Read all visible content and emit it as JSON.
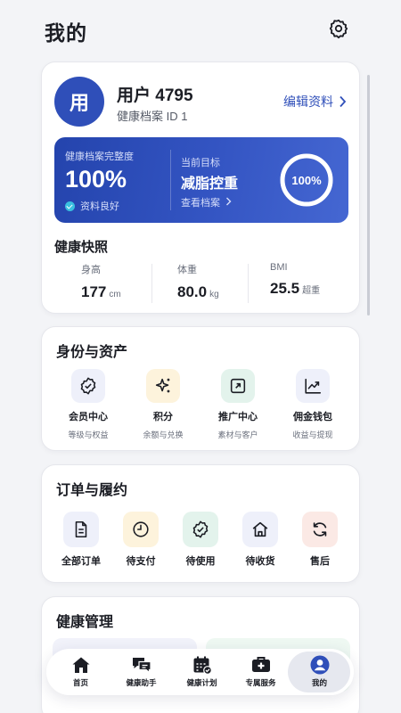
{
  "page": {
    "title": "我的"
  },
  "profile": {
    "avatar_text": "用",
    "name": "用户 4795",
    "subtitle": "健康档案 ID 1",
    "edit_label": "编辑资料",
    "banner": {
      "completeness_label": "健康档案完整度",
      "completeness_value": "100%",
      "status_text": "资料良好",
      "goal_label": "当前目标",
      "goal_value": "减脂控重",
      "view_label": "查看档案",
      "ring_text": "100%",
      "ring_progress": 1.0
    },
    "snapshot_title": "健康快照",
    "metrics": [
      {
        "label": "身高",
        "value": "177",
        "unit": "cm"
      },
      {
        "label": "体重",
        "value": "80.0",
        "unit": "kg"
      },
      {
        "label": "BMI",
        "value": "25.5",
        "unit": "超重"
      }
    ]
  },
  "identity": {
    "title": "身份与资产",
    "items": [
      {
        "label": "会员中心",
        "sub": "等级与权益",
        "icon": "badge-check-icon",
        "bg": "#eef0fa",
        "color": "#2f4fb9"
      },
      {
        "label": "积分",
        "sub": "余额与兑换",
        "icon": "sparkles-icon",
        "bg": "#fdf3dc",
        "color": "#1b1d24"
      },
      {
        "label": "推广中心",
        "sub": "素材与客户",
        "icon": "share-out-icon",
        "bg": "#e3f3ec",
        "color": "#1b1d24"
      },
      {
        "label": "佣金钱包",
        "sub": "收益与提现",
        "icon": "trend-chart-icon",
        "bg": "#eef0fa",
        "color": "#1b1d24"
      }
    ]
  },
  "orders": {
    "title": "订单与履约",
    "items": [
      {
        "label": "全部订单",
        "icon": "document-icon",
        "bg": "#eef0fa"
      },
      {
        "label": "待支付",
        "icon": "clock-icon",
        "bg": "#fdf3dc"
      },
      {
        "label": "待使用",
        "icon": "badge-check-icon",
        "bg": "#e3f3ec"
      },
      {
        "label": "待收货",
        "icon": "home-icon",
        "bg": "#eef0fa"
      },
      {
        "label": "售后",
        "icon": "refresh-icon",
        "bg": "#fbe9e5"
      }
    ]
  },
  "health": {
    "title": "健康管理"
  },
  "nav": {
    "items": [
      {
        "label": "首页",
        "icon": "home-icon"
      },
      {
        "label": "健康助手",
        "icon": "chat-icon"
      },
      {
        "label": "健康计划",
        "icon": "calendar-check-icon"
      },
      {
        "label": "专属服务",
        "icon": "medical-kit-icon"
      },
      {
        "label": "我的",
        "icon": "user-icon",
        "active": true
      }
    ]
  },
  "colors": {
    "accent": "#2f4fb9",
    "nav_active": "#2f4fb9"
  }
}
